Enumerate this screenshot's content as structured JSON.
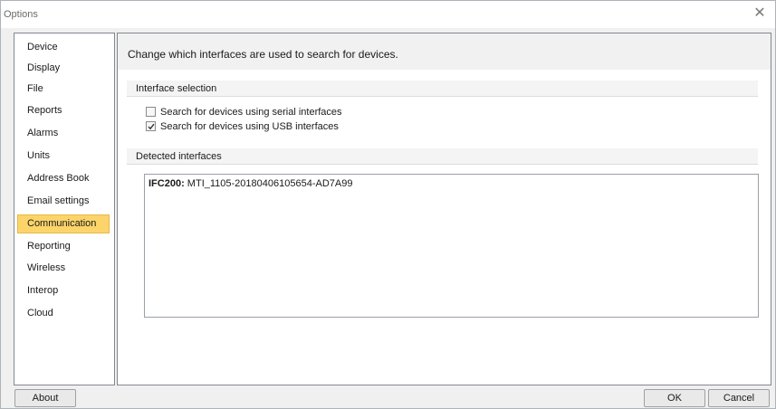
{
  "window": {
    "title": "Options",
    "close_glyph": "✕"
  },
  "sidebar": {
    "items": [
      {
        "label": "Device",
        "selected": false
      },
      {
        "label": "Display",
        "selected": false
      },
      {
        "label": "File",
        "selected": false
      },
      {
        "label": "Reports",
        "selected": false
      },
      {
        "label": "Alarms",
        "selected": false
      },
      {
        "label": "Units",
        "selected": false
      },
      {
        "label": "Address Book",
        "selected": false
      },
      {
        "label": "Email settings",
        "selected": false
      },
      {
        "label": "Communication",
        "selected": true
      },
      {
        "label": "Reporting",
        "selected": false
      },
      {
        "label": "Wireless",
        "selected": false
      },
      {
        "label": "Interop",
        "selected": false
      },
      {
        "label": "Cloud",
        "selected": false
      }
    ]
  },
  "main": {
    "header": "Change which interfaces are used to search for devices.",
    "interface_section": {
      "title": "Interface selection",
      "options": [
        {
          "label": "Search for devices using serial interfaces",
          "checked": false
        },
        {
          "label": "Search for devices using USB interfaces",
          "checked": true
        }
      ]
    },
    "detected_section": {
      "title": "Detected interfaces",
      "items": [
        {
          "name": "IFC200",
          "separator": ":",
          "value": " MTI_1105-20180406105654-AD7A99"
        }
      ]
    }
  },
  "footer": {
    "about_label": "About",
    "ok_label": "OK",
    "cancel_label": "Cancel"
  },
  "colors": {
    "selected_item": "#fcd46a",
    "border": "#828790"
  }
}
